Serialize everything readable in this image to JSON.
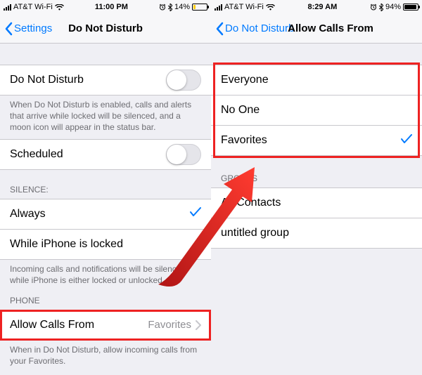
{
  "left": {
    "status": {
      "signal_text": "",
      "carrier": "AT&T Wi-Fi",
      "time": "11:00 PM",
      "bluetooth": true,
      "battery_pct": "14%"
    },
    "nav": {
      "back": "Settings",
      "title": "Do Not Disturb"
    },
    "dnd": {
      "label": "Do Not Disturb",
      "footer": "When Do Not Disturb is enabled, calls and alerts that arrive while locked will be silenced, and a moon icon will appear in the status bar."
    },
    "scheduled": {
      "label": "Scheduled"
    },
    "silence": {
      "header": "SILENCE:",
      "always": "Always",
      "locked": "While iPhone is locked",
      "footer": "Incoming calls and notifications will be silenced while iPhone is either locked or unlocked."
    },
    "phone": {
      "header": "PHONE",
      "allow_label": "Allow Calls From",
      "allow_value": "Favorites",
      "footer": "When in Do Not Disturb, allow incoming calls from your Favorites."
    }
  },
  "right": {
    "status": {
      "carrier": "AT&T Wi-Fi",
      "time": "8:29 AM",
      "bluetooth": true,
      "battery_pct": "94%"
    },
    "nav": {
      "back": "Do Not Disturb",
      "title": "Allow Calls From"
    },
    "options": {
      "everyone": "Everyone",
      "noone": "No One",
      "favorites": "Favorites"
    },
    "groups": {
      "header": "GROUPS",
      "all": "All Contacts",
      "untitled": "untitled group"
    }
  }
}
